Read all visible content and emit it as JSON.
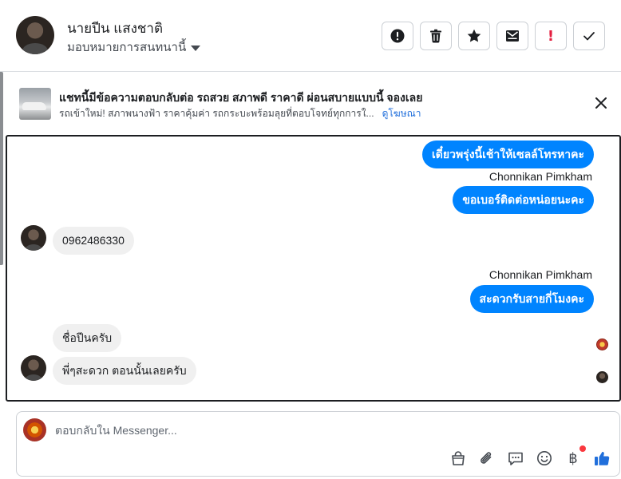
{
  "header": {
    "name": "นายปีน แสงชาติ",
    "assign_label": "มอบหมายการสนทนานี้",
    "actions": [
      "alert",
      "trash",
      "star",
      "mark-unread",
      "spam",
      "done"
    ]
  },
  "ad": {
    "title": "แชทนี้มีข้อความตอบกลับต่อ รถสวย สภาพดี ราคาดี ผ่อนสบายแบบนี้ จองเลย",
    "description": "รถเข้าใหม่! สภาพนางฟ้า ราคาคุ้มค่า รถกระบะพร้อมลุยที่ตอบโจทย์ทุกการใ...",
    "link": "ดูโฆษณา"
  },
  "messages": {
    "m1": "เดี๋ยวพรุ่งนี้เช้าให้เซลล์โทรหาคะ",
    "sender1": "Chonnikan Pimkham",
    "m2": "ขอเบอร์ติดต่อหน่อยนะคะ",
    "m3": "0962486330",
    "sender2": "Chonnikan Pimkham",
    "m4": "สะดวกรับสายกี่โมงคะ",
    "m5": "ชื่อปีนครับ",
    "m6": "พี่ๆสะดวก ตอนนั้นเลยครับ"
  },
  "composer": {
    "placeholder": "ตอบกลับใน Messenger...",
    "currency_symbol": "฿"
  },
  "colors": {
    "accent": "#0084ff",
    "incoming_bubble": "#f0f0f0",
    "link": "#216fdb",
    "danger": "#e41e3f"
  }
}
